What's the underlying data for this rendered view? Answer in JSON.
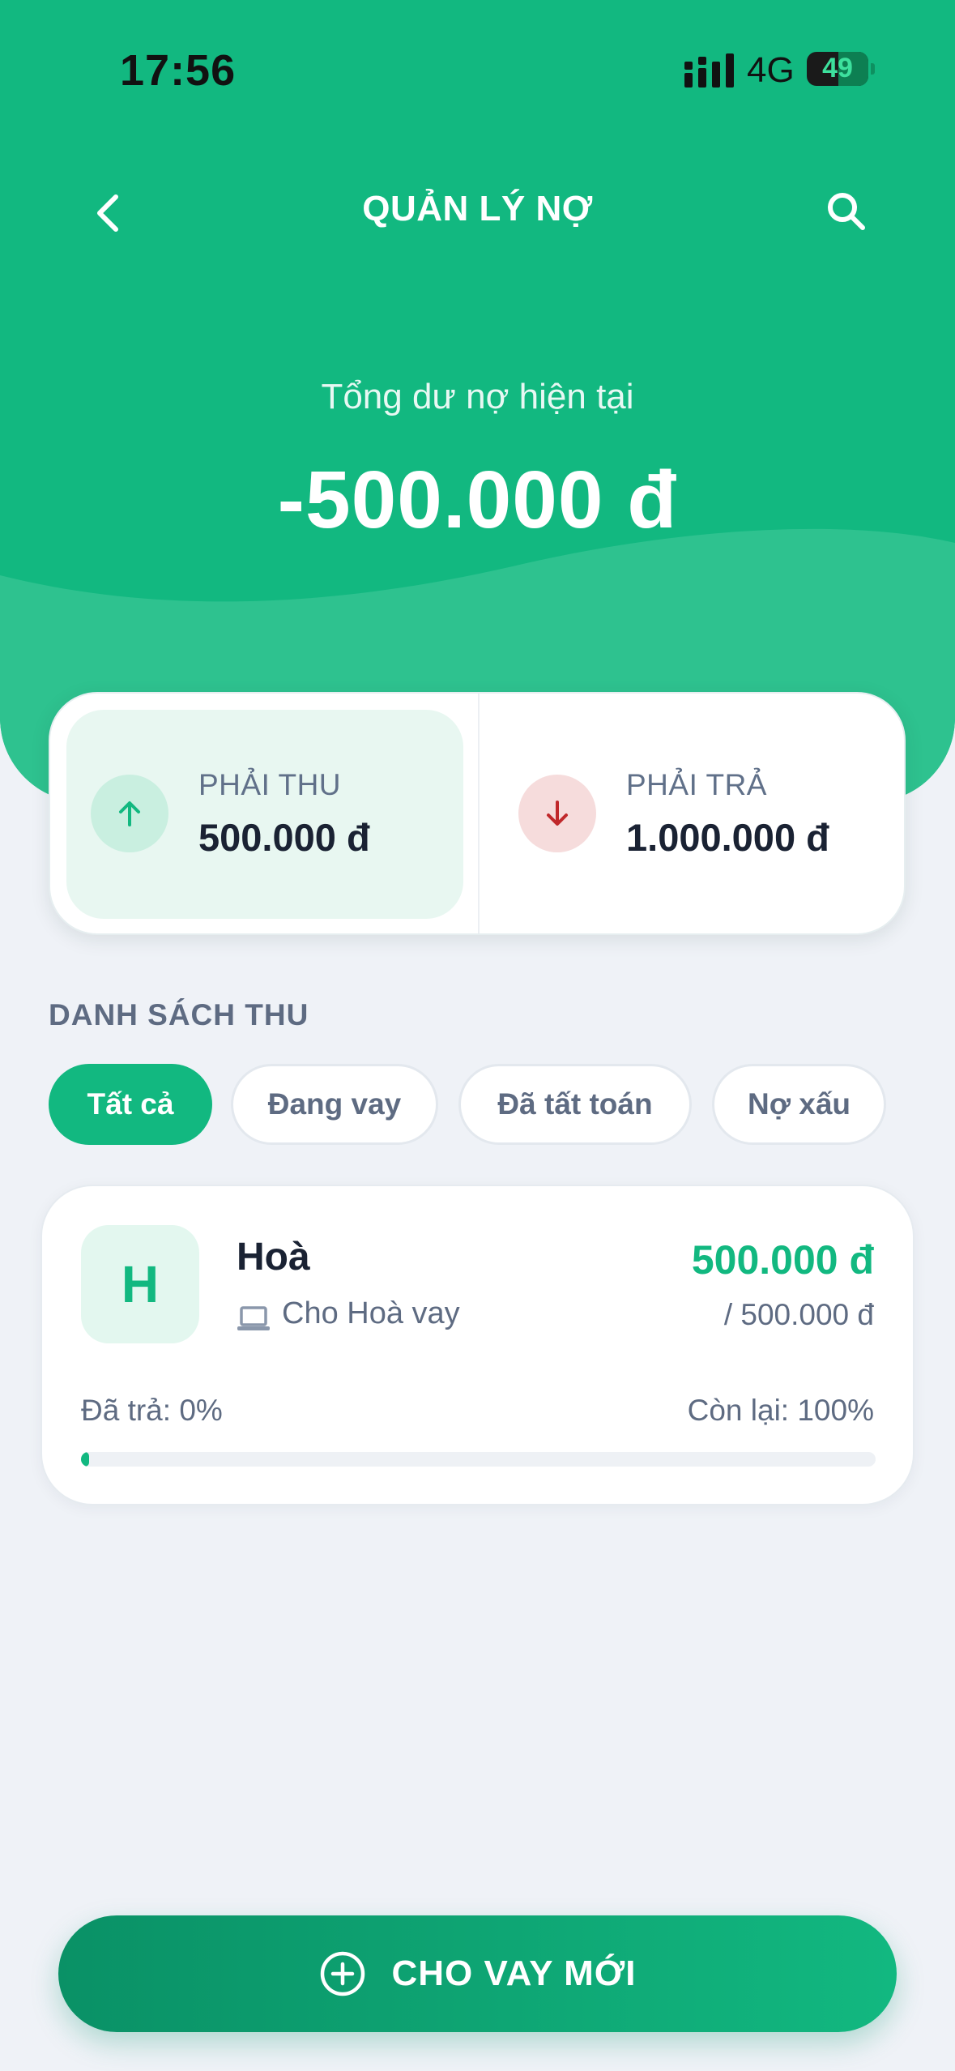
{
  "status_bar": {
    "time": "17:56",
    "network": "4G",
    "battery": "49",
    "battery_level": 0.49
  },
  "nav": {
    "title": "QUẢN LÝ NỢ"
  },
  "summary": {
    "total_label": "Tổng dư nợ hiện tại",
    "total_value": "-500.000 đ",
    "receivable_label": "PHẢI THU",
    "receivable_value": "500.000 đ",
    "payable_label": "PHẢI TRẢ",
    "payable_value": "1.000.000 đ"
  },
  "list": {
    "section_title": "DANH SÁCH THU",
    "filters": [
      "Tất cả",
      "Đang vay",
      "Đã tất toán",
      "Nợ xấu"
    ],
    "active_filter": "Tất cả",
    "items": [
      {
        "initial": "H",
        "name": "Hoà",
        "type_icon": "laptop-icon",
        "type": "Cho Hoà vay",
        "amount": "500.000 đ",
        "total": "/ 500.000 đ",
        "paid": "Đã trả: 0%",
        "remaining": "Còn lại: 100%",
        "progress_percent": 0
      }
    ]
  },
  "cta": {
    "label": "CHO VAY MỚI",
    "icon": "plus-circle-icon"
  },
  "colors": {
    "primary": "#12b880",
    "danger": "#c0282b",
    "background": "#eff2f7",
    "text_dark": "#1a2233",
    "text_muted": "#5e6b82"
  }
}
